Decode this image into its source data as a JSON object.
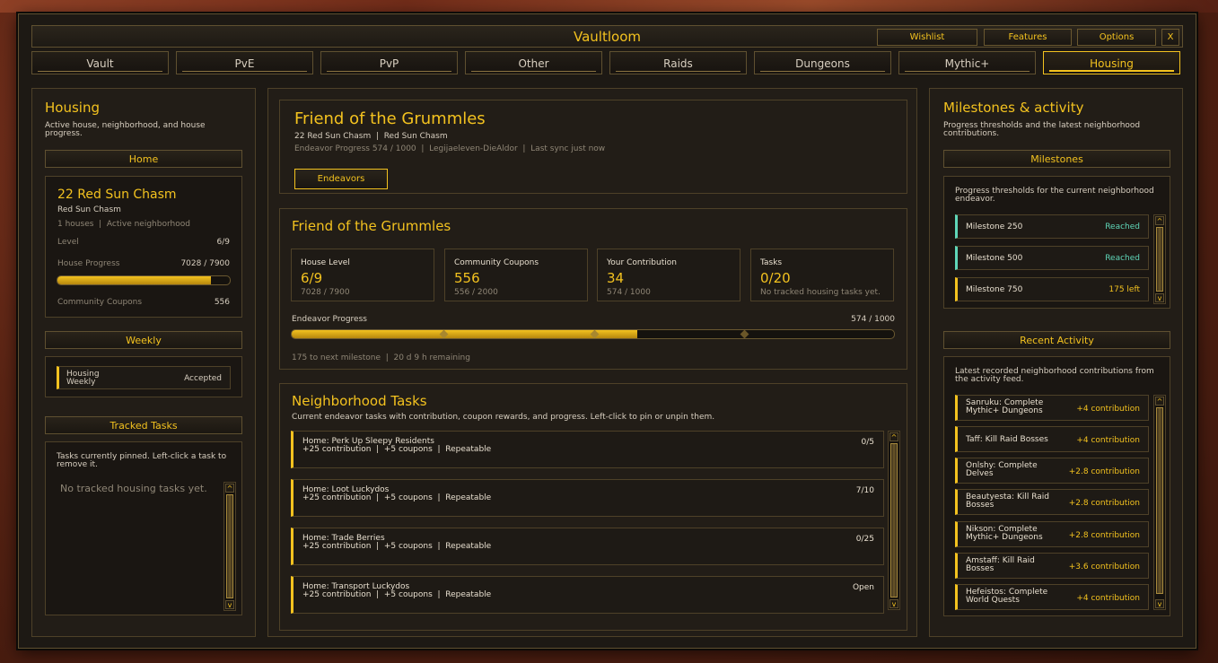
{
  "window": {
    "title": "Vaultloom",
    "buttons": {
      "wishlist": "Wishlist",
      "features": "Features",
      "options": "Options",
      "close": "X"
    }
  },
  "tabs": [
    "Vault",
    "PvE",
    "PvP",
    "Other",
    "Raids",
    "Dungeons",
    "Mythic+",
    "Housing"
  ],
  "active_tab": "Housing",
  "left": {
    "title": "Housing",
    "description": "Active house, neighborhood, and house progress.",
    "home_header": "Home",
    "home": {
      "name": "22 Red Sun Chasm",
      "sub": "Red Sun Chasm",
      "meta": "1 houses  |  Active neighborhood",
      "level_label": "Level",
      "level_value": "6/9",
      "progress_label": "House Progress",
      "progress_value": "7028 / 7900",
      "progress_fraction": 0.8896,
      "coupons_label": "Community Coupons",
      "coupons_value": "556"
    },
    "weekly_header": "Weekly",
    "weekly": {
      "label": "Housing Weekly",
      "status": "Accepted"
    },
    "tracked_header": "Tracked Tasks",
    "tracked_desc": "Tasks currently pinned. Left-click a task to remove it.",
    "tracked_empty": "No tracked housing tasks yet."
  },
  "center": {
    "hero": {
      "title": "Friend of the Grummles",
      "line1": "22 Red Sun Chasm  |  Red Sun Chasm",
      "line2": "Endeavor Progress 574 / 1000  |  Legijaeleven-DieAldor  |  Last sync just now",
      "button": "Endeavors"
    },
    "summary": {
      "title": "Friend of the Grummles",
      "cards": [
        {
          "label": "House Level",
          "value": "6/9",
          "sub": "7028 / 7900"
        },
        {
          "label": "Community Coupons",
          "value": "556",
          "sub": "556 / 2000"
        },
        {
          "label": "Your Contribution",
          "value": "34",
          "sub": "574 / 1000"
        },
        {
          "label": "Tasks",
          "value": "0/20",
          "sub": "No tracked housing tasks yet."
        }
      ],
      "progress_label": "Endeavor Progress",
      "progress_value": "574 / 1000",
      "progress_fraction": 0.574,
      "footer": "175 to next milestone  |  20 d 9 h remaining"
    },
    "tasks": {
      "title": "Neighborhood Tasks",
      "description": "Current endeavor tasks with contribution, coupon rewards, and progress. Left-click to pin or unpin them.",
      "items": [
        {
          "name": "Home: Perk Up Sleepy Residents",
          "detail": "+25 contribution  |  +5 coupons  |  Repeatable",
          "count": "0/5"
        },
        {
          "name": "Home: Loot Luckydos",
          "detail": "+25 contribution  |  +5 coupons  |  Repeatable",
          "count": "7/10"
        },
        {
          "name": "Home: Trade Berries",
          "detail": "+25 contribution  |  +5 coupons  |  Repeatable",
          "count": "0/25"
        },
        {
          "name": "Home: Transport Luckydos",
          "detail": "+25 contribution  |  +5 coupons  |  Repeatable",
          "count": "Open"
        }
      ]
    }
  },
  "right": {
    "title": "Milestones & activity",
    "description": "Progress thresholds and the latest neighborhood contributions.",
    "milestones_header": "Milestones",
    "milestones_desc": "Progress thresholds for the current neighborhood endeavor.",
    "milestones": [
      {
        "name": "Milestone 250",
        "status": "Reached"
      },
      {
        "name": "Milestone 500",
        "status": "Reached"
      },
      {
        "name": "Milestone 750",
        "status": "175 left"
      }
    ],
    "activity_header": "Recent Activity",
    "activity_desc": "Latest recorded neighborhood contributions from the activity feed.",
    "activity": [
      {
        "name": "Sanruku: Complete Mythic+ Dungeons",
        "amount": "+4 contribution"
      },
      {
        "name": "Taff: Kill Raid Bosses",
        "amount": "+4 contribution"
      },
      {
        "name": "Onlshy: Complete Delves",
        "amount": "+2.8 contribution"
      },
      {
        "name": "Beautyesta: Kill Raid Bosses",
        "amount": "+2.8 contribution"
      },
      {
        "name": "Nikson: Complete Mythic+ Dungeons",
        "amount": "+2.8 contribution"
      },
      {
        "name": "Amstaff: Kill Raid Bosses",
        "amount": "+3.6 contribution"
      },
      {
        "name": "Hefeistos: Complete World Quests",
        "amount": "+4 contribution"
      }
    ]
  },
  "scroll_arrows": {
    "up": "^",
    "down": "v"
  },
  "colors": {
    "gold": "#f3c21f",
    "teal": "#5fd6b8",
    "panel": "#221d17",
    "border": "#4e4128"
  }
}
